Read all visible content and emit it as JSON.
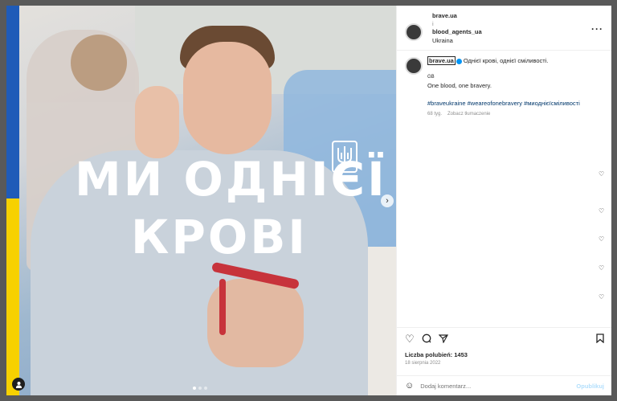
{
  "media": {
    "headline_line1": "МИ ОДНІЄЇ",
    "headline_line2": "КРОВІ",
    "next_icon": "chevron-right-icon",
    "carousel_count": 3,
    "carousel_active": 1,
    "colors": {
      "flag_blue": "#1f5bb8",
      "flag_yellow": "#f7d100"
    }
  },
  "header": {
    "username": "brave.ua",
    "separator": "i",
    "collaborator": "blood_agents_ua",
    "location": "Ukraina",
    "more_icon": "more-horizontal-icon"
  },
  "caption": {
    "username": "brave.ua",
    "text": "Однієї крові, однієї сміливості.",
    "lang": "GB",
    "translation": "One blood, one bravery.",
    "hashtags": "#braveukraine #weareofonebravery #миоднієїсміливості",
    "time_ago": "68 tyg.",
    "translate_link": "Zobacz tłumaczenie"
  },
  "actions": {
    "likes": "Liczba polubień: 1453",
    "date": "18 sierpnia 2022"
  },
  "comment_box": {
    "placeholder": "Dodaj komentarz...",
    "publish": "Opublikuj"
  }
}
